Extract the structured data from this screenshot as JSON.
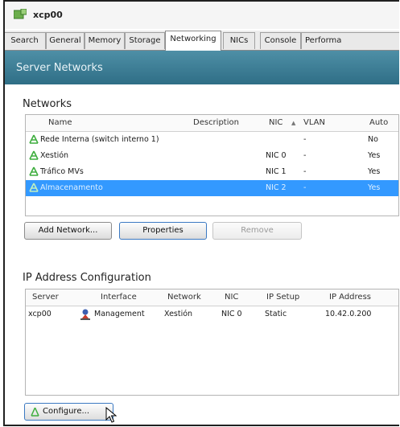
{
  "window": {
    "title": "xcp00"
  },
  "tabs": [
    {
      "label": "Search"
    },
    {
      "label": "General"
    },
    {
      "label": "Memory"
    },
    {
      "label": "Storage"
    },
    {
      "label": "Networking"
    },
    {
      "label": "NICs"
    },
    {
      "label": "Console"
    },
    {
      "label": "Performa"
    }
  ],
  "banner": {
    "title": "Server Networks"
  },
  "networks": {
    "title": "Networks",
    "columns": {
      "name": "Name",
      "description": "Description",
      "nic": "NIC",
      "sort_arrow": "▲",
      "vlan": "VLAN",
      "auto": "Auto"
    },
    "rows": [
      {
        "name": "Rede Interna (switch interno 1)",
        "description": "",
        "nic": "",
        "vlan": "-",
        "auto": "No"
      },
      {
        "name": "Xestión",
        "description": "",
        "nic": "NIC 0",
        "vlan": "-",
        "auto": "Yes"
      },
      {
        "name": "Tráfico MVs",
        "description": "",
        "nic": "NIC 1",
        "vlan": "-",
        "auto": "Yes"
      },
      {
        "name": "Almacenamento",
        "description": "",
        "nic": "NIC 2",
        "vlan": "-",
        "auto": "Yes"
      }
    ],
    "buttons": {
      "add": "Add Network...",
      "properties": "Properties",
      "remove": "Remove"
    }
  },
  "ip_config": {
    "title": "IP Address Configuration",
    "columns": {
      "server": "Server",
      "interface": "Interface",
      "network": "Network",
      "nic": "NIC",
      "ip_setup": "IP Setup",
      "ip_address": "IP Address"
    },
    "rows": [
      {
        "server": "xcp00",
        "interface": "Management",
        "network": "Xestión",
        "nic": "NIC 0",
        "ip_setup": "Static",
        "ip_address": "10.42.0.200"
      }
    ],
    "buttons": {
      "configure": "Configure..."
    }
  },
  "colors": {
    "banner": "#3a7b93",
    "selection": "#3399ff",
    "network_icon": "#3fae3f"
  }
}
